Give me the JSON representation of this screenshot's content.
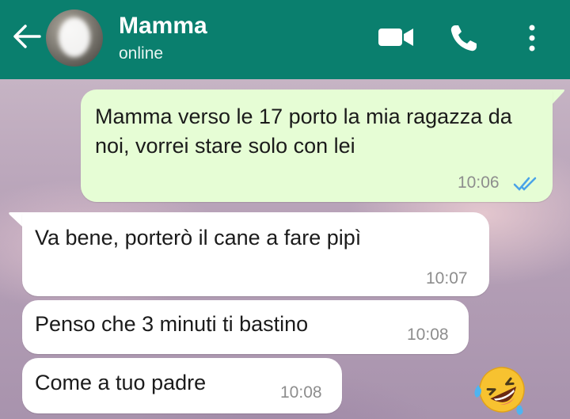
{
  "header": {
    "contact_name": "Mamma",
    "status": "online",
    "icons": [
      "back-arrow-icon",
      "video-call-icon",
      "phone-icon",
      "more-options-icon"
    ],
    "color": "#0a7f6e"
  },
  "messages": [
    {
      "direction": "outgoing",
      "text": "Mamma verso le 17  porto la mia ragazza da noi, vorrei stare solo con lei",
      "time": "10:06",
      "read": true
    },
    {
      "direction": "incoming",
      "text": "Va bene, porterò il cane a fare pipì",
      "time": "10:07"
    },
    {
      "direction": "incoming",
      "text": "Penso che 3 minuti ti bastino",
      "time": "10:08"
    },
    {
      "direction": "incoming",
      "text": "Come a tuo padre",
      "time": "10:08"
    }
  ],
  "reaction_emoji": "rolling-on-the-floor-laughing"
}
